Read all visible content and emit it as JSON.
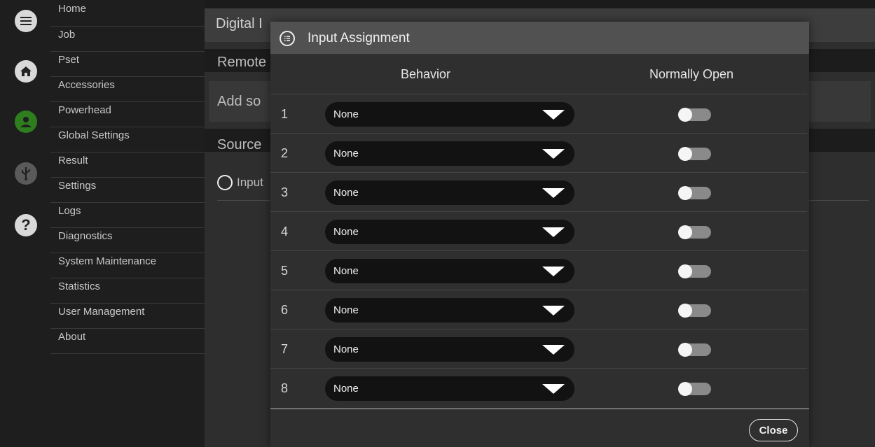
{
  "menu": {
    "items": [
      {
        "label": "Home",
        "has_submenu": false
      },
      {
        "label": "Job",
        "has_submenu": false
      },
      {
        "label": "Pset",
        "has_submenu": false
      },
      {
        "label": "Accessories",
        "has_submenu": false
      },
      {
        "label": "Powerhead",
        "has_submenu": false
      },
      {
        "label": "Global Settings",
        "has_submenu": false
      },
      {
        "label": "Result",
        "has_submenu": true
      },
      {
        "label": "Settings",
        "has_submenu": true
      },
      {
        "label": "Logs",
        "has_submenu": true
      },
      {
        "label": "Diagnostics",
        "has_submenu": true
      },
      {
        "label": "System Maintenance",
        "has_submenu": true
      },
      {
        "label": "Statistics",
        "has_submenu": false
      },
      {
        "label": "User Management",
        "has_submenu": false
      },
      {
        "label": "About",
        "has_submenu": false
      }
    ]
  },
  "rail": {
    "icons": [
      "menu-icon",
      "home-icon",
      "user-icon",
      "usb-icon",
      "help-icon"
    ],
    "active_color": "#2e7d1f"
  },
  "background": {
    "title": "Digital I",
    "row1": "Remote",
    "row2": "Add so",
    "row3": "Source",
    "input_link": "Input"
  },
  "modal": {
    "title": "Input Assignment",
    "col_behavior": "Behavior",
    "col_normally_open": "Normally Open",
    "rows": [
      {
        "num": "1",
        "behavior": "None",
        "normally_open": false
      },
      {
        "num": "2",
        "behavior": "None",
        "normally_open": false
      },
      {
        "num": "3",
        "behavior": "None",
        "normally_open": false
      },
      {
        "num": "4",
        "behavior": "None",
        "normally_open": false
      },
      {
        "num": "5",
        "behavior": "None",
        "normally_open": false
      },
      {
        "num": "6",
        "behavior": "None",
        "normally_open": false
      },
      {
        "num": "7",
        "behavior": "None",
        "normally_open": false
      },
      {
        "num": "8",
        "behavior": "None",
        "normally_open": false
      }
    ],
    "close_label": "Close"
  }
}
